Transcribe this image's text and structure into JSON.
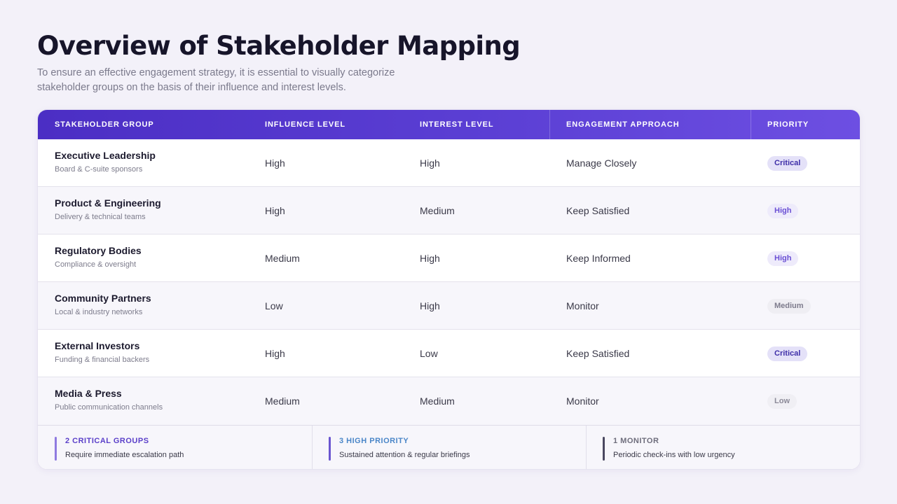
{
  "header": {
    "title": "Overview of Stakeholder Mapping",
    "subtitle": "To ensure an effective engagement strategy, it is essential to visually categorize stakeholder groups on the basis of their influence and interest levels."
  },
  "table": {
    "columns": [
      "STAKEHOLDER GROUP",
      "INFLUENCE LEVEL",
      "INTEREST LEVEL",
      "ENGAGEMENT APPROACH",
      "PRIORITY"
    ],
    "rows": [
      {
        "name": "Executive Leadership",
        "sub": "Board & C-suite sponsors",
        "influence": "High",
        "interest": "High",
        "approach": "Manage Closely",
        "priority": "Critical"
      },
      {
        "name": "Product & Engineering",
        "sub": "Delivery & technical teams",
        "influence": "High",
        "interest": "Medium",
        "approach": "Keep Satisfied",
        "priority": "High"
      },
      {
        "name": "Regulatory Bodies",
        "sub": "Compliance & oversight",
        "influence": "Medium",
        "interest": "High",
        "approach": "Keep Informed",
        "priority": "High"
      },
      {
        "name": "Community Partners",
        "sub": "Local & industry networks",
        "influence": "Low",
        "interest": "High",
        "approach": "Monitor",
        "priority": "Medium"
      },
      {
        "name": "External Investors",
        "sub": "Funding & financial backers",
        "influence": "High",
        "interest": "Low",
        "approach": "Keep Satisfied",
        "priority": "Critical"
      },
      {
        "name": "Media & Press",
        "sub": "Public communication channels",
        "influence": "Medium",
        "interest": "Medium",
        "approach": "Monitor",
        "priority": "Low"
      }
    ]
  },
  "summary": [
    {
      "title": "2 CRITICAL GROUPS",
      "desc": "Require immediate escalation path",
      "color": "#5a3fc9",
      "bar": "#8f7ae0"
    },
    {
      "title": "3 HIGH PRIORITY",
      "desc": "Sustained attention & regular briefings",
      "color": "#4a86c8",
      "bar": "#6a56d0"
    },
    {
      "title": "1 MONITOR",
      "desc": "Periodic check-ins with low urgency",
      "color": "#6e6d7c",
      "bar": "#4a4860"
    }
  ]
}
